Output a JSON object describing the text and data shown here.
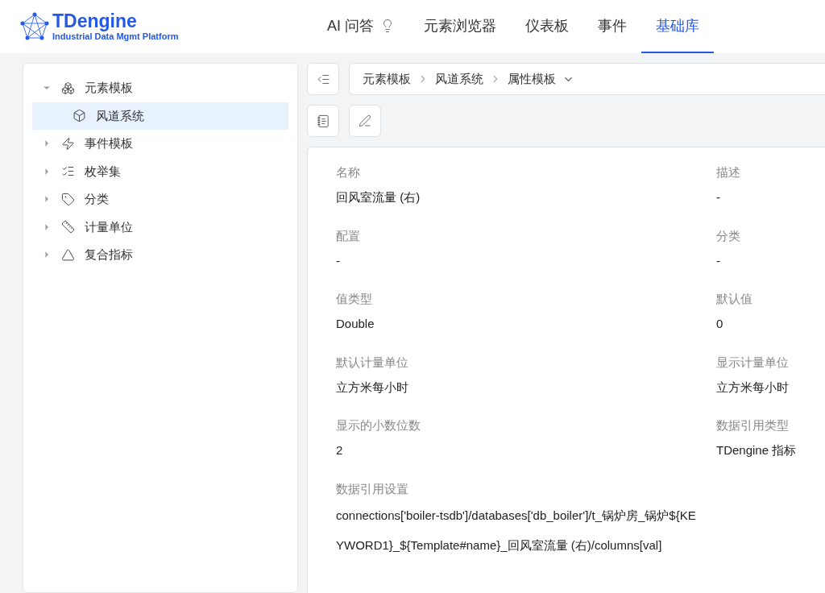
{
  "logo": {
    "name": "TDengine",
    "tagline": "Industrial Data Mgmt Platform"
  },
  "nav": [
    {
      "label": "AI 问答",
      "selected": false
    },
    {
      "label": "元素浏览器",
      "selected": false
    },
    {
      "label": "仪表板",
      "selected": false
    },
    {
      "label": "事件",
      "selected": false
    },
    {
      "label": "基础库",
      "selected": true
    }
  ],
  "tree": [
    {
      "label": "元素模板",
      "expanded": true,
      "children": [
        {
          "label": "风道系统",
          "selected": true
        }
      ]
    },
    {
      "label": "事件模板",
      "expanded": false
    },
    {
      "label": "枚举集",
      "expanded": false
    },
    {
      "label": "分类",
      "expanded": false
    },
    {
      "label": "计量单位",
      "expanded": false
    },
    {
      "label": "复合指标",
      "expanded": false
    }
  ],
  "breadcrumb": [
    "元素模板",
    "风道系统",
    "属性模板"
  ],
  "fields": [
    {
      "label": "名称",
      "value": "回风室流量 (右)"
    },
    {
      "label": "描述",
      "value": "-"
    },
    {
      "label": "配置",
      "value": "-"
    },
    {
      "label": "分类",
      "value": "-"
    },
    {
      "label": "值类型",
      "value": "Double"
    },
    {
      "label": "默认值",
      "value": "0"
    },
    {
      "label": "默认计量单位",
      "value": "立方米每小时"
    },
    {
      "label": "显示计量单位",
      "value": "立方米每小时"
    },
    {
      "label": "显示的小数位数",
      "value": "2"
    },
    {
      "label": "数据引用类型",
      "value": "TDengine 指标"
    },
    {
      "label": "数据引用设置",
      "value": "connections['boiler-tsdb']/databases['db_boiler']/t_锅炉房_锅炉${KEYWORD1}_${Template#name}_回风室流量 (右)/columns[val]"
    }
  ]
}
